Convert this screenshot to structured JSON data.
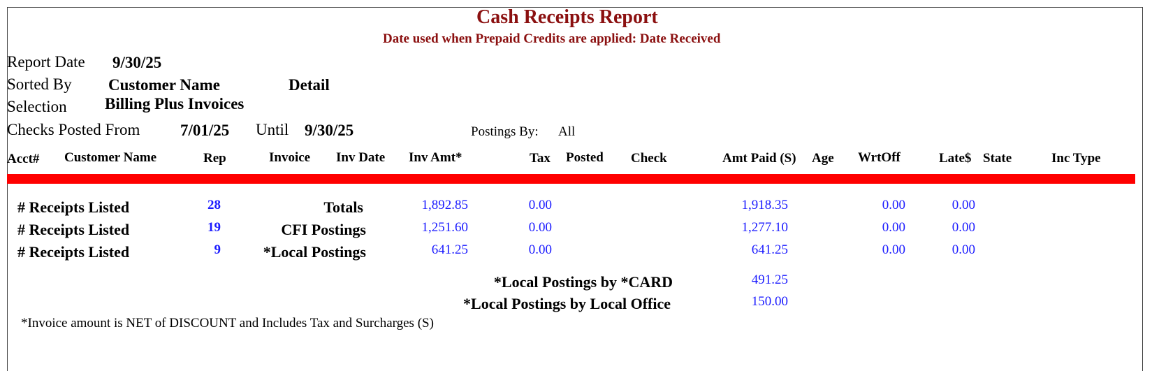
{
  "report": {
    "title": "Cash Receipts Report",
    "subtitle": "Date used when Prepaid Credits are applied: Date Received"
  },
  "meta": {
    "report_date_label": "Report Date",
    "report_date": "9/30/25",
    "sorted_by_label": "Sorted By",
    "sorted_by": "Customer Name",
    "sorted_detail": "Detail",
    "selection_label": "Selection",
    "selection": "Billing Plus Invoices",
    "checks_posted_label": "Checks Posted From",
    "checks_from": "7/01/25",
    "until_label": "Until",
    "checks_until": "9/30/25",
    "postings_by_label": "Postings By:",
    "postings_by": "All"
  },
  "columns": {
    "acct": "Acct#",
    "customer_name": "Customer Name",
    "rep": "Rep",
    "invoice": "Invoice",
    "inv_date": "Inv Date",
    "inv_amt": "Inv Amt*",
    "tax": "Tax",
    "posted": "Posted",
    "check": "Check",
    "amt_paid": "Amt Paid (S)",
    "age": "Age",
    "wrtoff": "WrtOff",
    "late": "Late$",
    "state": "State",
    "inc_type": "Inc Type"
  },
  "summary": [
    {
      "label": "# Receipts Listed",
      "count": "28",
      "name": "Totals",
      "inv_amt": "1,892.85",
      "tax": "0.00",
      "amt_paid": "1,918.35",
      "wrtoff": "0.00",
      "late": "0.00"
    },
    {
      "label": "# Receipts Listed",
      "count": "19",
      "name": "CFI Postings",
      "inv_amt": "1,251.60",
      "tax": "0.00",
      "amt_paid": "1,277.10",
      "wrtoff": "0.00",
      "late": "0.00"
    },
    {
      "label": "# Receipts Listed",
      "count": "9",
      "name": "*Local Postings",
      "inv_amt": "641.25",
      "tax": "0.00",
      "amt_paid": "641.25",
      "wrtoff": "0.00",
      "late": "0.00"
    }
  ],
  "local_breakdown": [
    {
      "label": "*Local Postings by *CARD",
      "value": "491.25"
    },
    {
      "label": "*Local Postings by Local Office",
      "value": "150.00"
    }
  ],
  "footnote": "*Invoice amount is NET of DISCOUNT and Includes Tax and Surcharges (S)",
  "colors": {
    "title": "#8b1010",
    "bar": "#ff0000",
    "numbers": "#1a1aff"
  }
}
